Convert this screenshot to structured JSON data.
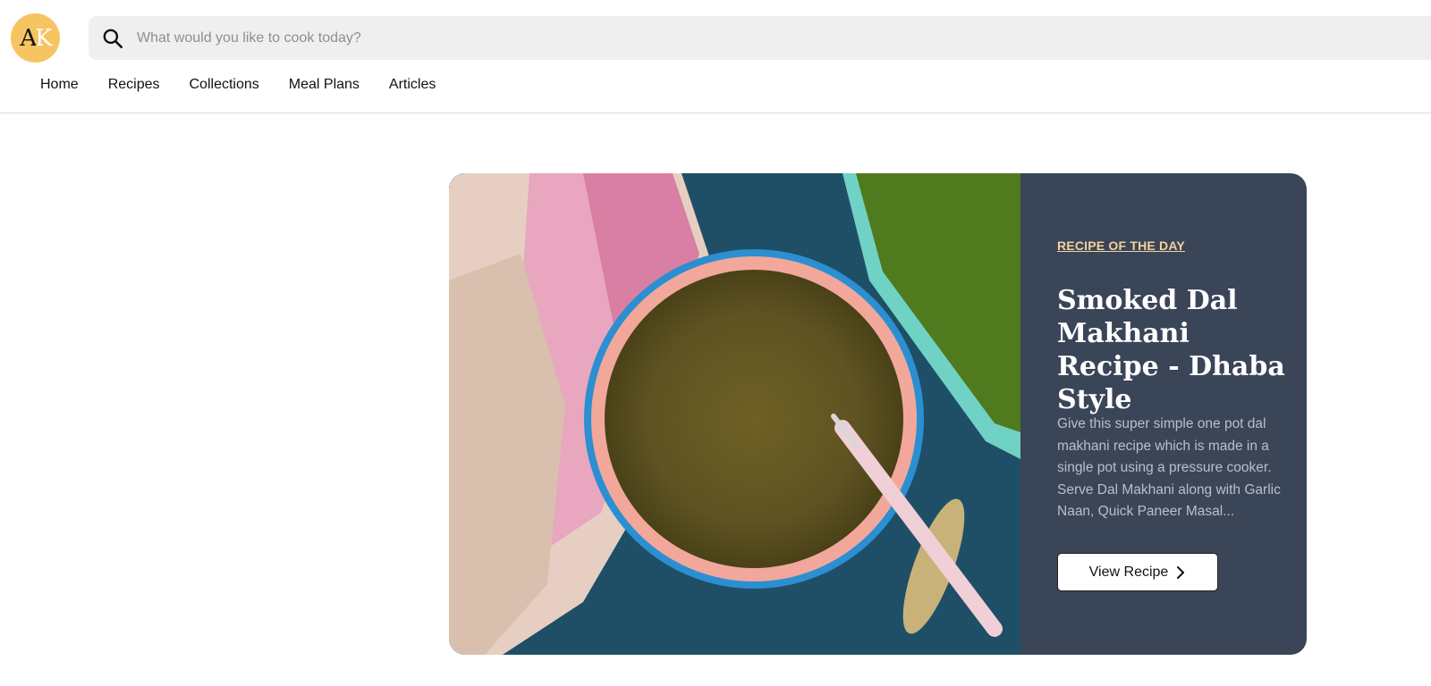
{
  "logo": {
    "letter_a": "A",
    "letter_k": "K"
  },
  "search": {
    "placeholder": "What would you like to cook today?",
    "value": ""
  },
  "nav": {
    "items": [
      "Home",
      "Recipes",
      "Collections",
      "Meal Plans",
      "Articles"
    ]
  },
  "feature": {
    "eyebrow": "RECIPE OF THE DAY",
    "title": "Smoked Dal Makhani Recipe - Dhaba Style",
    "description": "Give this super simple one pot dal makhani recipe which is made in a single pot using a pressure cooker. Serve Dal Makhani along with Garlic Naan, Quick Paneer Masal...",
    "button_label": "View Recipe",
    "image_alt": "Bowl of dal makhani with a spoon"
  },
  "colors": {
    "logo_bg": "#f7c462",
    "card_panel": "#3a4558",
    "eyebrow": "#f2d29a",
    "search_bg": "#efefef"
  },
  "icons": {
    "search": "search-icon",
    "chevron": "chevron-right-icon"
  }
}
